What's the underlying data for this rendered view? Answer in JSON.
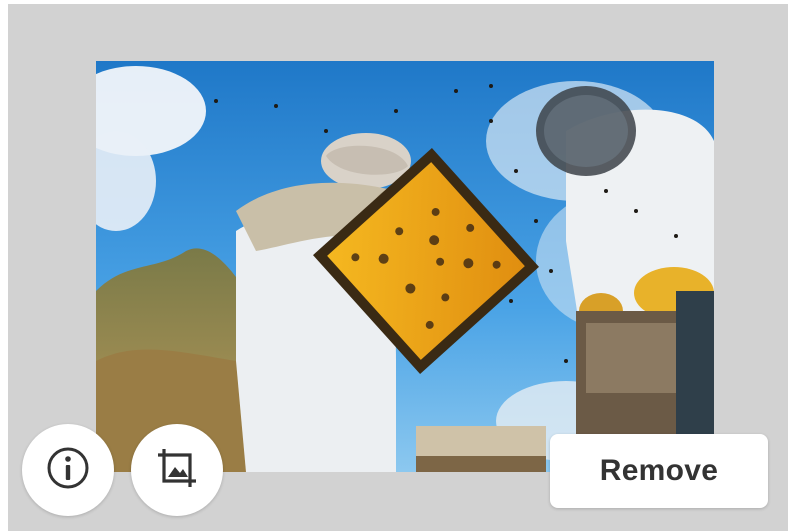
{
  "image": {
    "alt": "beekeepers-photo"
  },
  "toolbar": {
    "info_icon": "info-icon",
    "crop_icon": "crop-image-icon",
    "remove_label": "Remove"
  },
  "colors": {
    "panel_background": "#d2d2d2",
    "button_background": "#ffffff",
    "text": "#333333"
  }
}
